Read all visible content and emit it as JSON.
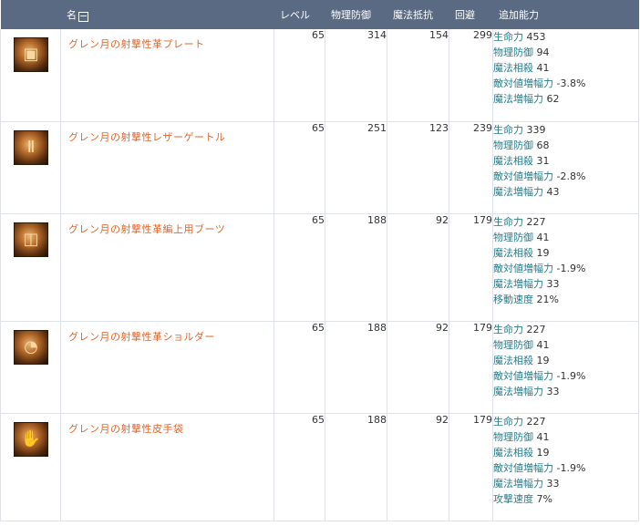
{
  "header": {
    "name": "名",
    "toggle": "−",
    "level": "レベル",
    "pdef": "物理防御",
    "mres": "魔法抵抗",
    "evade": "回避",
    "bonus": "追加能力"
  },
  "items": [
    {
      "icon": "chest-armor-icon",
      "glyph": "▣",
      "name": "グレン月の射撃性革プレート",
      "level": "65",
      "pdef": "314",
      "mres": "154",
      "evade": "299",
      "stats": [
        {
          "label": "生命力",
          "value": "453"
        },
        {
          "label": "物理防御",
          "value": "94"
        },
        {
          "label": "魔法相殺",
          "value": "41"
        },
        {
          "label": "敵対値増幅力",
          "value": "-3.8%"
        },
        {
          "label": "魔法増幅力",
          "value": "62"
        }
      ]
    },
    {
      "icon": "leg-armor-icon",
      "glyph": "Ⅱ",
      "name": "グレン月の射撃性レザーゲートル",
      "level": "65",
      "pdef": "251",
      "mres": "123",
      "evade": "239",
      "stats": [
        {
          "label": "生命力",
          "value": "339"
        },
        {
          "label": "物理防御",
          "value": "68"
        },
        {
          "label": "魔法相殺",
          "value": "31"
        },
        {
          "label": "敵対値増幅力",
          "value": "-2.8%"
        },
        {
          "label": "魔法増幅力",
          "value": "43"
        }
      ]
    },
    {
      "icon": "boots-icon",
      "glyph": "◫",
      "name": "グレン月の射撃性革編上用ブーツ",
      "level": "65",
      "pdef": "188",
      "mres": "92",
      "evade": "179",
      "stats": [
        {
          "label": "生命力",
          "value": "227"
        },
        {
          "label": "物理防御",
          "value": "41"
        },
        {
          "label": "魔法相殺",
          "value": "19"
        },
        {
          "label": "敵対値増幅力",
          "value": "-1.9%"
        },
        {
          "label": "魔法増幅力",
          "value": "33"
        },
        {
          "label": "移動速度",
          "value": "21%"
        }
      ]
    },
    {
      "icon": "shoulder-armor-icon",
      "glyph": "◔",
      "name": "グレン月の射撃性革ショルダー",
      "level": "65",
      "pdef": "188",
      "mres": "92",
      "evade": "179",
      "stats": [
        {
          "label": "生命力",
          "value": "227"
        },
        {
          "label": "物理防御",
          "value": "41"
        },
        {
          "label": "魔法相殺",
          "value": "19"
        },
        {
          "label": "敵対値増幅力",
          "value": "-1.9%"
        },
        {
          "label": "魔法増幅力",
          "value": "33"
        }
      ]
    },
    {
      "icon": "gloves-icon",
      "glyph": "✋",
      "name": "グレン月の射撃性皮手袋",
      "level": "65",
      "pdef": "188",
      "mres": "92",
      "evade": "179",
      "stats": [
        {
          "label": "生命力",
          "value": "227"
        },
        {
          "label": "物理防御",
          "value": "41"
        },
        {
          "label": "魔法相殺",
          "value": "19"
        },
        {
          "label": "敵対値増幅力",
          "value": "-1.9%"
        },
        {
          "label": "魔法増幅力",
          "value": "33"
        },
        {
          "label": "攻撃速度",
          "value": "7%"
        }
      ]
    }
  ]
}
